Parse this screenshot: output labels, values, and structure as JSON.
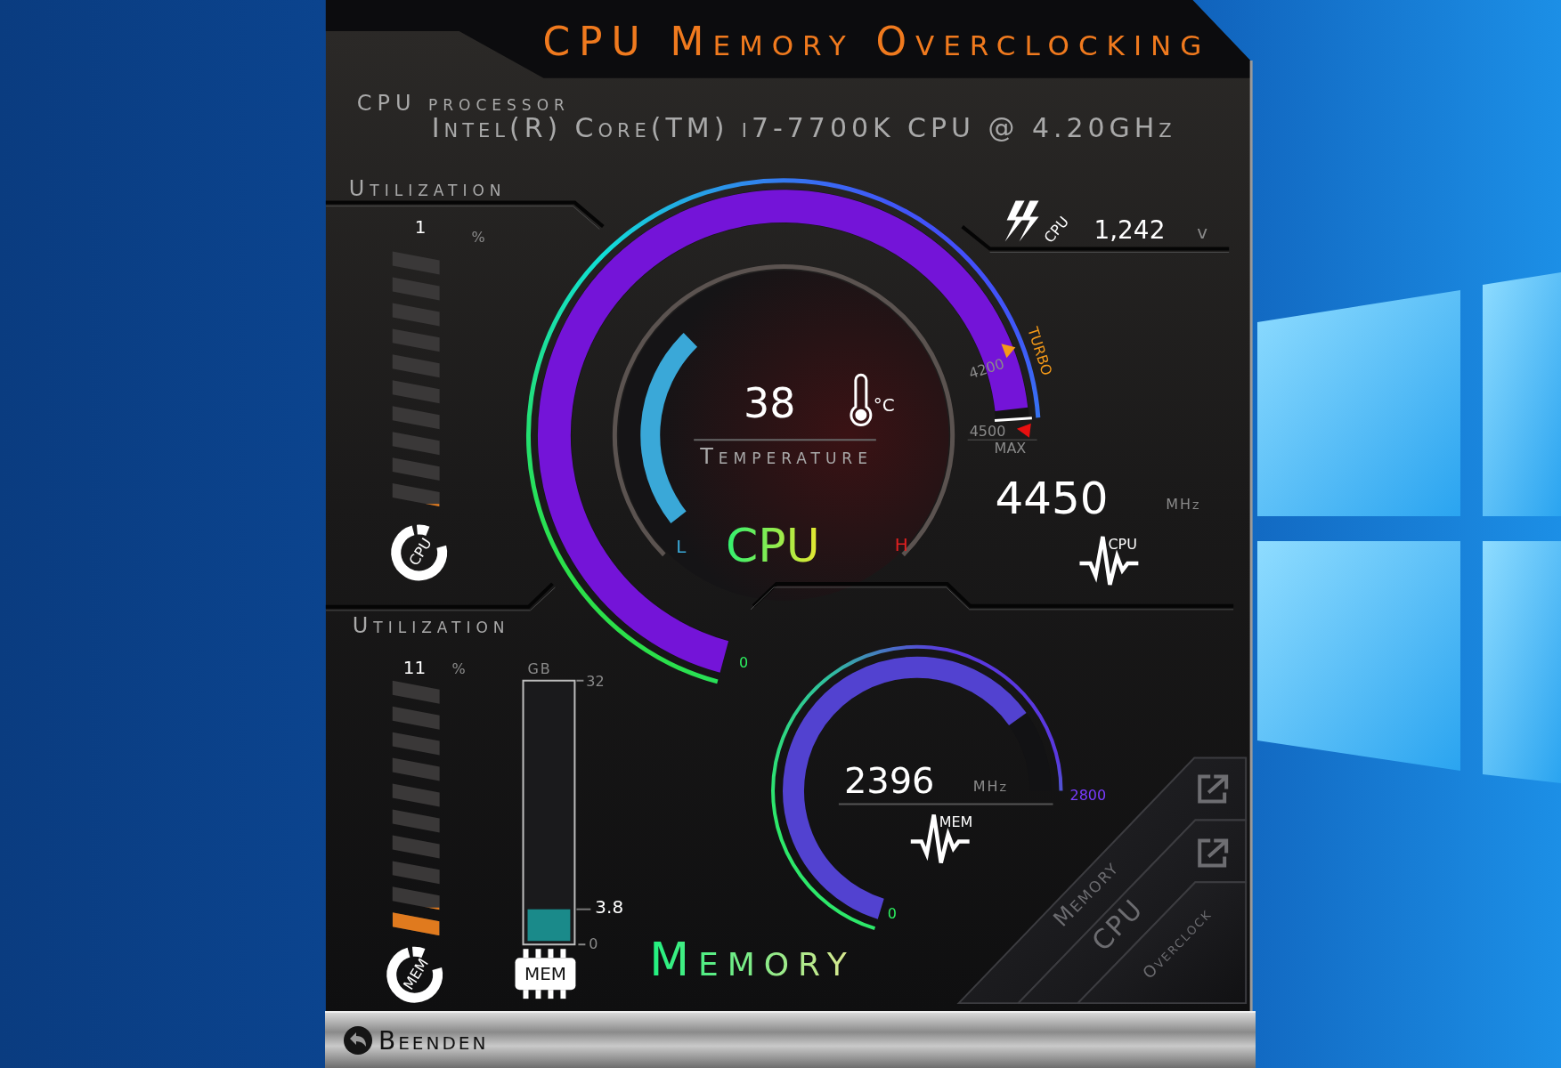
{
  "title": "CPU Memory Overclocking",
  "processor": {
    "label": "CPU processor",
    "name": "Intel(R) Core(TM) i7-7700K CPU @ 4.20GHz"
  },
  "cpu_utilization": {
    "label": "Utilization",
    "value": "1",
    "unit": "%",
    "level": 0.01,
    "icon_label": "CPU"
  },
  "voltage": {
    "icon_label": "CPU",
    "value": "1,242",
    "unit": "v"
  },
  "cpu_frequency": {
    "level": 0.99,
    "min": "0",
    "turbo_value": "4200",
    "turbo_label": "TURBO",
    "max_value": "4500",
    "max_label": "MAX",
    "value": "4450",
    "unit": "MHz",
    "icon_label": "CPU"
  },
  "temperature": {
    "value": "38",
    "unit": "°C",
    "label": "Temperature",
    "level": 0.31,
    "low": "L",
    "high": "H"
  },
  "cpu_label": "CPU",
  "memory_utilization": {
    "label": "Utilization",
    "value": "11",
    "unit": "%",
    "level": 0.11,
    "icon_label": "MEM"
  },
  "memory_usage": {
    "unit": "GB",
    "max": "32",
    "value": "3.8",
    "min": "0",
    "level": 0.12,
    "chip_label": "MEM"
  },
  "memory_frequency": {
    "value": "2396",
    "unit": "MHz",
    "max": "2800",
    "min": "0",
    "level": 0.86,
    "icon_label": "MEM"
  },
  "memory_label": "Memory",
  "side_tabs": [
    {
      "label": "Memory",
      "link": true
    },
    {
      "label": "CPU",
      "link": true
    },
    {
      "label": "Overclock",
      "link": false
    }
  ],
  "exit_button": "Beenden"
}
